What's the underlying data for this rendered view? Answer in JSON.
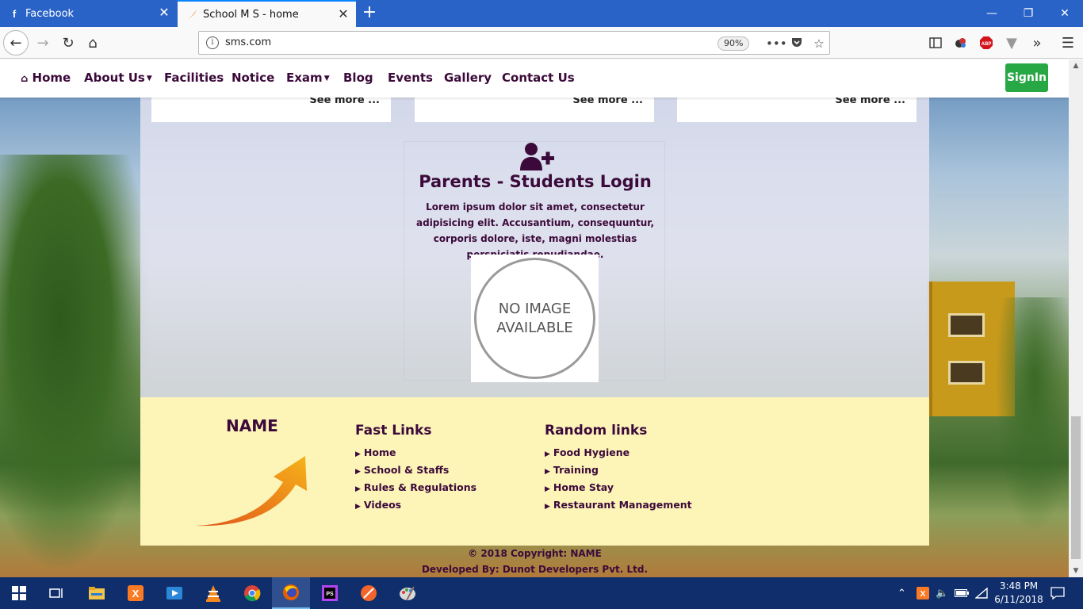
{
  "browser": {
    "tabs": [
      {
        "title": "Facebook",
        "favicon": "facebook-icon"
      },
      {
        "title": "School M S - home",
        "favicon": "firefox-flame-icon",
        "active": true
      }
    ],
    "url": "sms.com",
    "zoom": "90%"
  },
  "site": {
    "nav": {
      "items": [
        {
          "label": "Home",
          "icon": "home-icon"
        },
        {
          "label": "About Us",
          "dropdown": true
        },
        {
          "label": "Facilities"
        },
        {
          "label": "Notice"
        },
        {
          "label": "Exam",
          "dropdown": true
        },
        {
          "label": "Blog"
        },
        {
          "label": "Events"
        },
        {
          "label": "Gallery"
        },
        {
          "label": "Contact Us"
        }
      ],
      "signin_label": "SignIn"
    },
    "cards": [
      {
        "see_more": "See more ..."
      },
      {
        "see_more": "See more ..."
      },
      {
        "see_more": "See more ..."
      }
    ],
    "login": {
      "icon": "user-plus-icon",
      "title": "Parents - Students Login",
      "text": "Lorem ipsum dolor sit amet, consectetur adipisicing elit. Accusantium, consequuntur, corporis dolore, iste, magni molestias perspiciatis repudiandae.",
      "no_image_line1": "NO IMAGE",
      "no_image_line2": "AVAILABLE"
    },
    "footer": {
      "name": "NAME",
      "fast_links": {
        "title": "Fast Links",
        "items": [
          "Home",
          "School & Staffs",
          "Rules & Regulations",
          "Videos"
        ]
      },
      "random_links": {
        "title": "Random links",
        "items": [
          "Food Hygiene",
          "Training",
          "Home Stay",
          "Restaurant Management"
        ]
      },
      "copyright": "© 2018 Copyright: NAME",
      "developed_by": "Developed By: Dunot Developers Pvt. Ltd."
    }
  },
  "taskbar": {
    "time": "3:48 PM",
    "date": "6/11/2018"
  }
}
